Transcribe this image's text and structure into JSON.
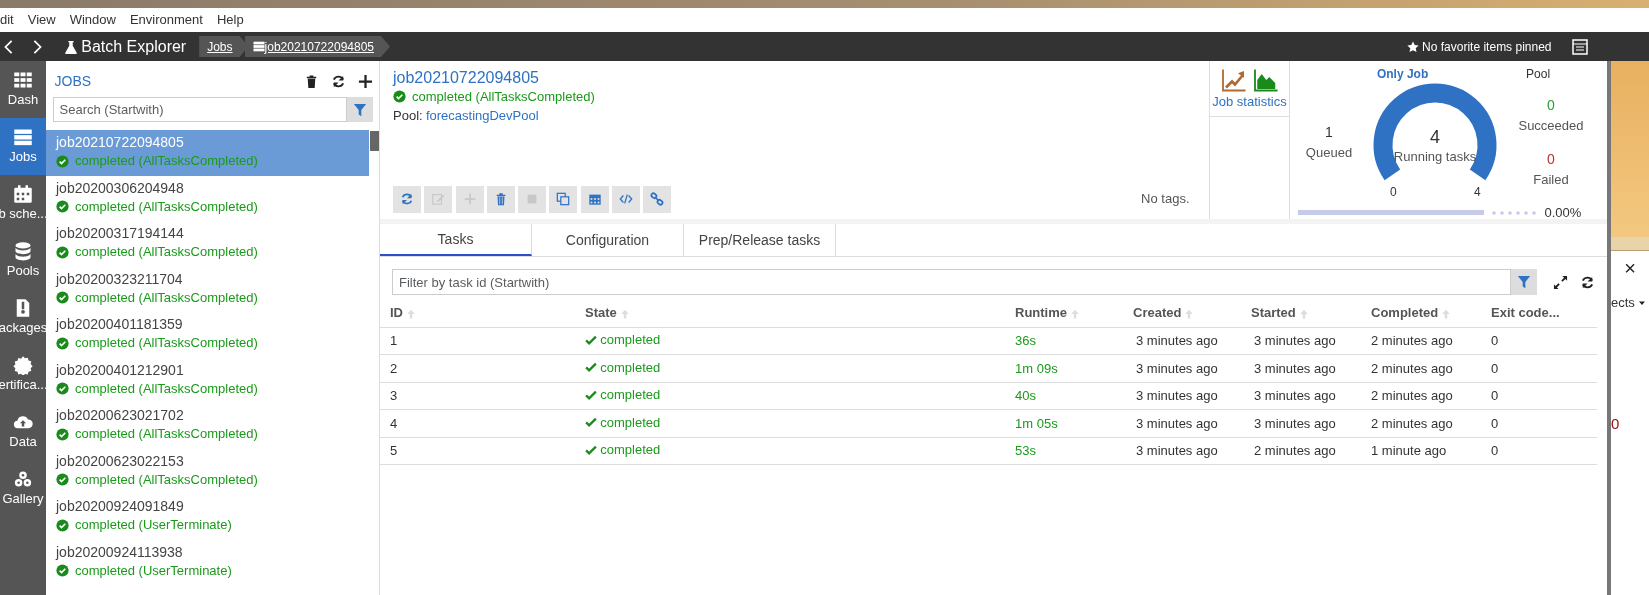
{
  "menu": [
    "dit",
    "View",
    "Window",
    "Environment",
    "Help"
  ],
  "navbar": {
    "title": "Batch Explorer",
    "breadcrumbs": [
      {
        "label": "Jobs"
      },
      {
        "label": "job20210722094805"
      }
    ],
    "favorites": "No favorite items pinned"
  },
  "sidebar": [
    {
      "label": "Dash",
      "selected": false
    },
    {
      "label": "Jobs",
      "selected": true
    },
    {
      "label": "b sche...",
      "selected": false
    },
    {
      "label": "Pools",
      "selected": false
    },
    {
      "label": "ackages",
      "selected": false
    },
    {
      "label": "ertifica...",
      "selected": false
    },
    {
      "label": "Data",
      "selected": false
    },
    {
      "label": "Gallery",
      "selected": false
    }
  ],
  "jobs_panel": {
    "title": "JOBS",
    "search": {
      "placeholder": "Search (Startwith)"
    },
    "jobs": [
      {
        "name": "job20210722094805",
        "status": "completed (AllTasksCompleted)",
        "selected": true
      },
      {
        "name": "job20200306204948",
        "status": "completed (AllTasksCompleted)",
        "selected": false
      },
      {
        "name": "job20200317194144",
        "status": "completed (AllTasksCompleted)",
        "selected": false
      },
      {
        "name": "job20200323211704",
        "status": "completed (AllTasksCompleted)",
        "selected": false
      },
      {
        "name": "job20200401181359",
        "status": "completed (AllTasksCompleted)",
        "selected": false
      },
      {
        "name": "job20200401212901",
        "status": "completed (AllTasksCompleted)",
        "selected": false
      },
      {
        "name": "job20200623021702",
        "status": "completed (AllTasksCompleted)",
        "selected": false
      },
      {
        "name": "job20200623022153",
        "status": "completed (AllTasksCompleted)",
        "selected": false
      },
      {
        "name": "job20200924091849",
        "status": "completed (UserTerminate)",
        "selected": false
      },
      {
        "name": "job20200924113938",
        "status": "completed (UserTerminate)",
        "selected": false
      }
    ]
  },
  "job": {
    "name": "job20210722094805",
    "status": "completed (AllTasksCompleted)",
    "pool_label": "Pool:",
    "pool": "forecastingDevPool",
    "tags": "No tags.",
    "actions": [
      {
        "disabled": false
      },
      {
        "disabled": true
      },
      {
        "disabled": true
      },
      {
        "disabled": false
      },
      {
        "disabled": true
      },
      {
        "disabled": false
      },
      {
        "disabled": false
      },
      {
        "disabled": false
      },
      {
        "disabled": false
      }
    ]
  },
  "statistics": {
    "label": "Job statistics"
  },
  "gauge": {
    "tabs": [
      {
        "label": "Only Job",
        "selected": true
      },
      {
        "label": "Pool",
        "selected": false
      }
    ],
    "queued": "1",
    "queued_label": "Queued",
    "running": "4",
    "running_label": "Running tasks",
    "min": "0",
    "max": "4",
    "succeeded": "0",
    "succeeded_label": "Succeeded",
    "failed": "0",
    "failed_label": "Failed",
    "progress": "0.00%"
  },
  "tabs": [
    {
      "label": "Tasks",
      "selected": true
    },
    {
      "label": "Configuration",
      "selected": false
    },
    {
      "label": "Prep/Release tasks",
      "selected": false
    }
  ],
  "tasks": {
    "filter": {
      "placeholder": "Filter by task id (Startwith)"
    },
    "columns": [
      "ID",
      "State",
      "Runtime",
      "Created",
      "Started",
      "Completed",
      "Exit code..."
    ],
    "rows": [
      [
        "1",
        "completed",
        "36s",
        "3 minutes ago",
        "3 minutes ago",
        "2 minutes ago",
        "0"
      ],
      [
        "2",
        "completed",
        "1m 09s",
        "3 minutes ago",
        "3 minutes ago",
        "2 minutes ago",
        "0"
      ],
      [
        "3",
        "completed",
        "40s",
        "3 minutes ago",
        "3 minutes ago",
        "2 minutes ago",
        "0"
      ],
      [
        "4",
        "completed",
        "1m 05s",
        "3 minutes ago",
        "3 minutes ago",
        "2 minutes ago",
        "0"
      ],
      [
        "5",
        "completed",
        "53s",
        "3 minutes ago",
        "2 minutes ago",
        "1 minute ago",
        "0"
      ]
    ]
  },
  "background_window": {
    "close": "×",
    "label": "ects",
    "value": "0"
  }
}
